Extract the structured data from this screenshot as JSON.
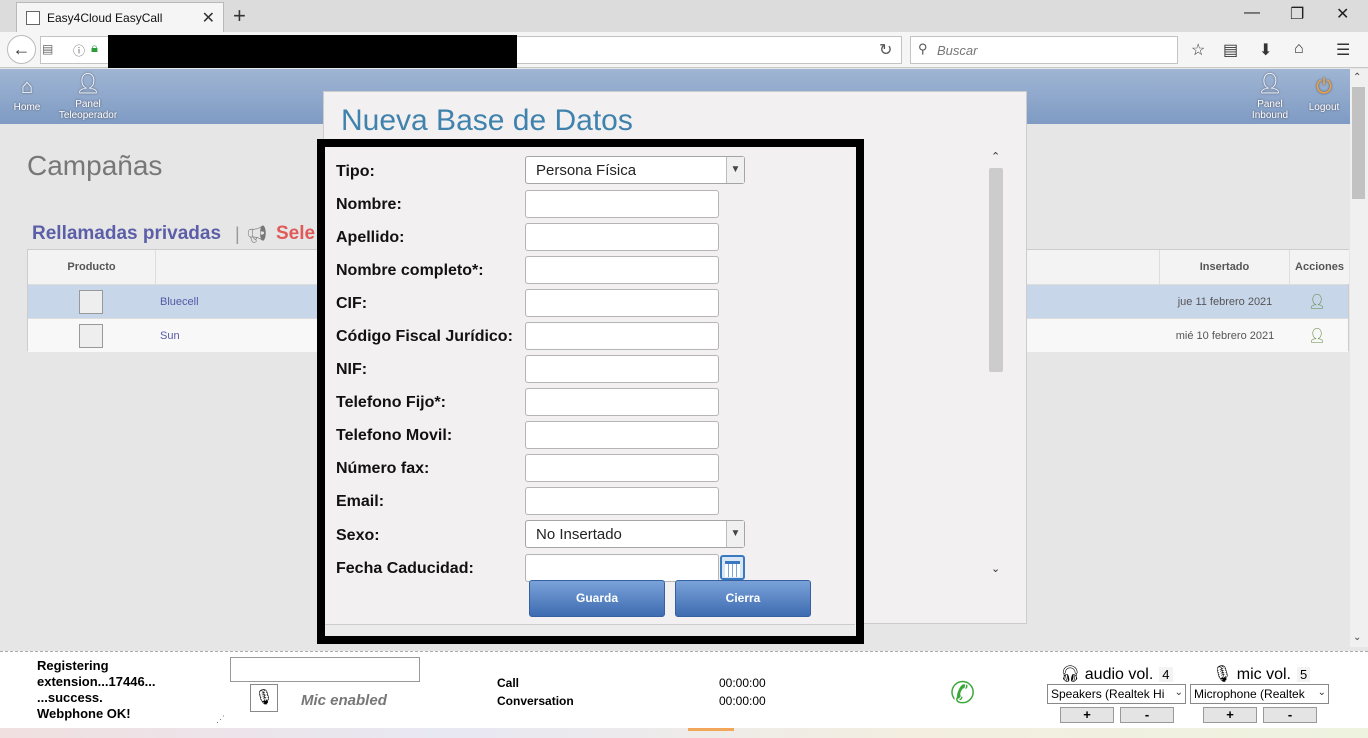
{
  "browser": {
    "tab_title": "Easy4Cloud EasyCall",
    "search_placeholder": "Buscar"
  },
  "header": {
    "home": "Home",
    "panel_teleoperador_1": "Panel",
    "panel_teleoperador_2": "Teleoperador",
    "panel_inbound_1": "Panel",
    "panel_inbound_2": "Inbound",
    "logout": "Logout"
  },
  "page": {
    "title": "Campañas",
    "subtitle": "Rellamadas privadas",
    "subtitle_separator": "|",
    "subtitle_cut": "Sele"
  },
  "table": {
    "headers": {
      "producto": "Producto",
      "insertado": "Insertado",
      "acciones": "Acciones"
    },
    "rows": [
      {
        "name": "Bluecell",
        "date": "jue 11 febrero 2021"
      },
      {
        "name": "Sun",
        "date": "mié 10 febrero 2021"
      }
    ]
  },
  "modal": {
    "title": "Nueva Base de Datos",
    "fields": {
      "tipo": "Tipo:",
      "nombre": "Nombre:",
      "apellido": "Apellido:",
      "nombre_completo": "Nombre completo*:",
      "cif": "CIF:",
      "codigo_fiscal": "Código Fiscal Jurídico:",
      "nif": "NIF:",
      "telefono_fijo": "Telefono Fijo*:",
      "telefono_movil": "Telefono Movil:",
      "numero_fax": "Número fax:",
      "email": "Email:",
      "sexo": "Sexo:",
      "fecha_caducidad": "Fecha Caducidad:"
    },
    "tipo_value": "Persona Física",
    "sexo_value": "No Insertado",
    "save_label": "Guarda",
    "close_label": "Cierra"
  },
  "webphone": {
    "log": [
      "Registering",
      "extension...17446...",
      "...success.",
      "Webphone OK!"
    ],
    "mic_status": "Mic enabled",
    "call_label": "Call",
    "call_time": "00:00:00",
    "conversation_label": "Conversation",
    "conversation_time": "00:00:00",
    "audio_vol_label": "audio vol.",
    "audio_vol_value": "4",
    "mic_vol_label": "mic vol.",
    "mic_vol_value": "5",
    "speakers_device": "Speakers (Realtek Hi",
    "microphone_device": "Microphone (Realtek",
    "plus": "+",
    "minus": "-"
  }
}
